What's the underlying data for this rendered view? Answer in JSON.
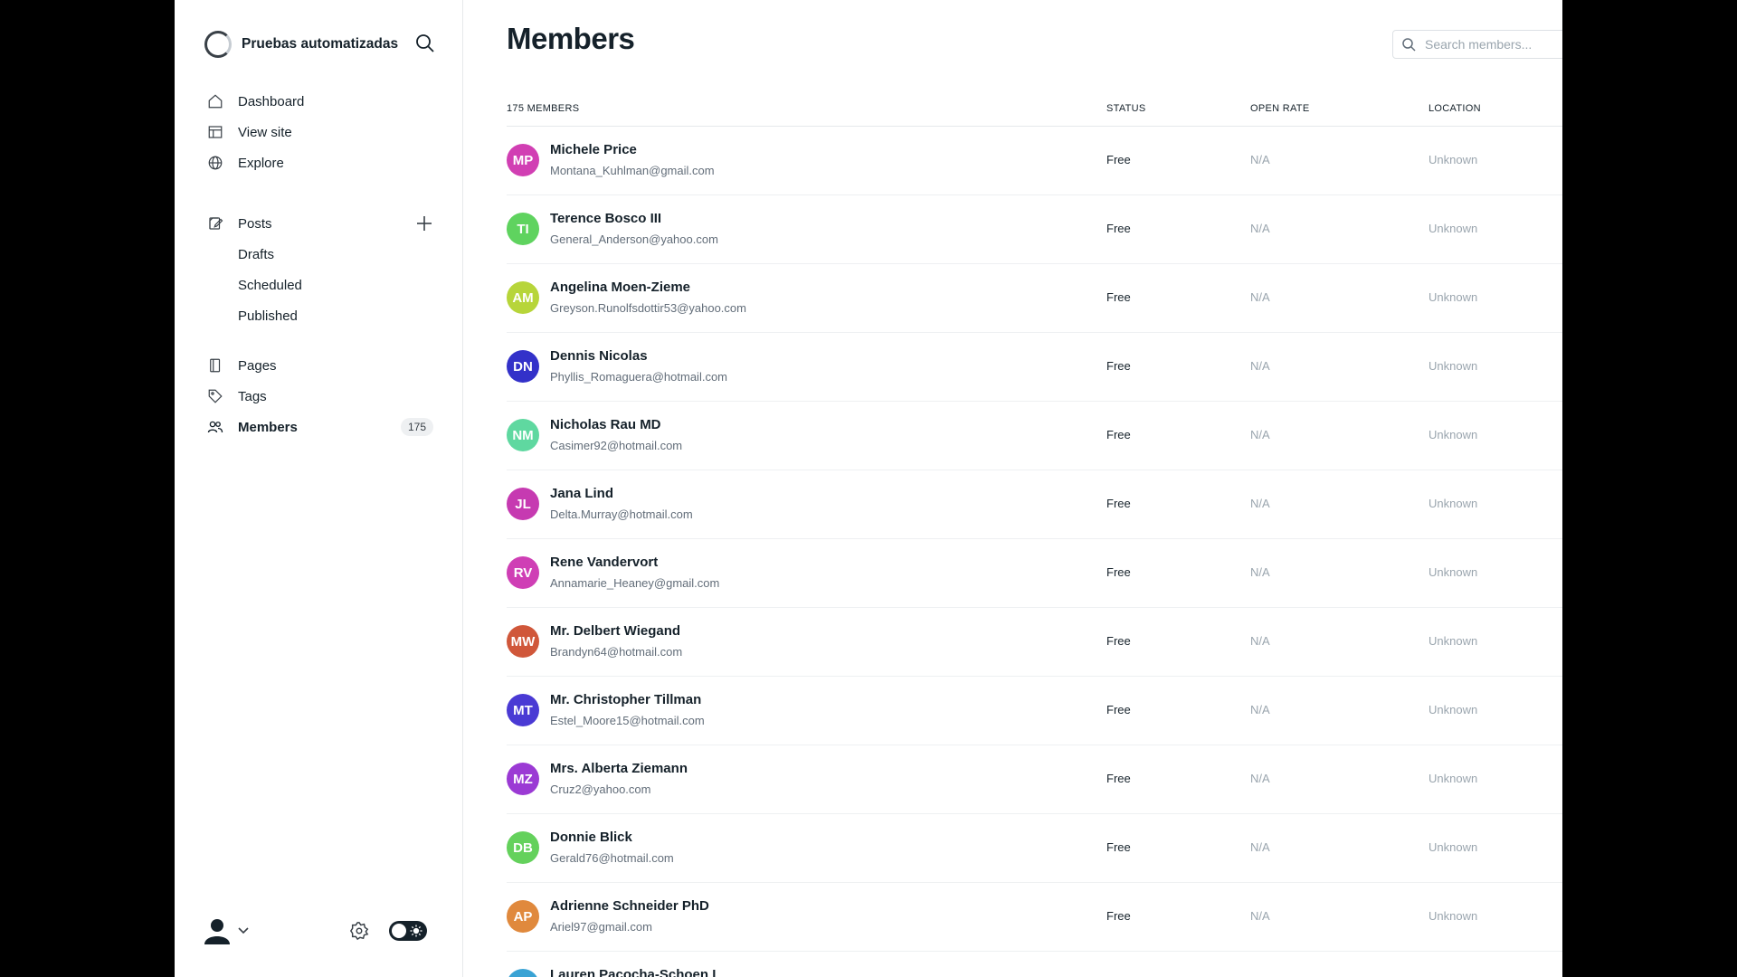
{
  "brand": {
    "title": "Pruebas automatizadas"
  },
  "nav": {
    "dashboard": "Dashboard",
    "view_site": "View site",
    "explore": "Explore",
    "posts": "Posts",
    "drafts": "Drafts",
    "scheduled": "Scheduled",
    "published": "Published",
    "pages": "Pages",
    "tags": "Tags",
    "members": "Members",
    "members_count": "175"
  },
  "main": {
    "title": "Members",
    "search_placeholder": "Search members...",
    "columns": {
      "count": "175 MEMBERS",
      "status": "STATUS",
      "open_rate": "OPEN RATE",
      "location": "LOCATION"
    }
  },
  "members": [
    {
      "initials": "MP",
      "name": "Michele Price",
      "email": "Montana_Kuhlman@gmail.com",
      "status": "Free",
      "open_rate": "N/A",
      "location": "Unknown",
      "color": "#d13fb3"
    },
    {
      "initials": "TI",
      "name": "Terence Bosco III",
      "email": "General_Anderson@yahoo.com",
      "status": "Free",
      "open_rate": "N/A",
      "location": "Unknown",
      "color": "#5fd35f"
    },
    {
      "initials": "AM",
      "name": "Angelina Moen-Zieme",
      "email": "Greyson.Runolfsdottir53@yahoo.com",
      "status": "Free",
      "open_rate": "N/A",
      "location": "Unknown",
      "color": "#b7d53a"
    },
    {
      "initials": "DN",
      "name": "Dennis Nicolas",
      "email": "Phyllis_Romaguera@hotmail.com",
      "status": "Free",
      "open_rate": "N/A",
      "location": "Unknown",
      "color": "#3331c9"
    },
    {
      "initials": "NM",
      "name": "Nicholas Rau MD",
      "email": "Casimer92@hotmail.com",
      "status": "Free",
      "open_rate": "N/A",
      "location": "Unknown",
      "color": "#5fd8a0"
    },
    {
      "initials": "JL",
      "name": "Jana Lind",
      "email": "Delta.Murray@hotmail.com",
      "status": "Free",
      "open_rate": "N/A",
      "location": "Unknown",
      "color": "#c63ab1"
    },
    {
      "initials": "RV",
      "name": "Rene Vandervort",
      "email": "Annamarie_Heaney@gmail.com",
      "status": "Free",
      "open_rate": "N/A",
      "location": "Unknown",
      "color": "#cf3fb5"
    },
    {
      "initials": "MW",
      "name": "Mr. Delbert Wiegand",
      "email": "Brandyn64@hotmail.com",
      "status": "Free",
      "open_rate": "N/A",
      "location": "Unknown",
      "color": "#d0573a"
    },
    {
      "initials": "MT",
      "name": "Mr. Christopher Tillman",
      "email": "Estel_Moore15@hotmail.com",
      "status": "Free",
      "open_rate": "N/A",
      "location": "Unknown",
      "color": "#4a3ad4"
    },
    {
      "initials": "MZ",
      "name": "Mrs. Alberta Ziemann",
      "email": "Cruz2@yahoo.com",
      "status": "Free",
      "open_rate": "N/A",
      "location": "Unknown",
      "color": "#9b3ad4"
    },
    {
      "initials": "DB",
      "name": "Donnie Blick",
      "email": "Gerald76@hotmail.com",
      "status": "Free",
      "open_rate": "N/A",
      "location": "Unknown",
      "color": "#64d15c"
    },
    {
      "initials": "AP",
      "name": "Adrienne Schneider PhD",
      "email": "Ariel97@gmail.com",
      "status": "Free",
      "open_rate": "N/A",
      "location": "Unknown",
      "color": "#e0893d"
    },
    {
      "initials": "",
      "name": "Lauren Pacocha-Schoen I",
      "email": "",
      "status": "",
      "open_rate": "",
      "location": "",
      "color": "#3aa3d4"
    }
  ]
}
